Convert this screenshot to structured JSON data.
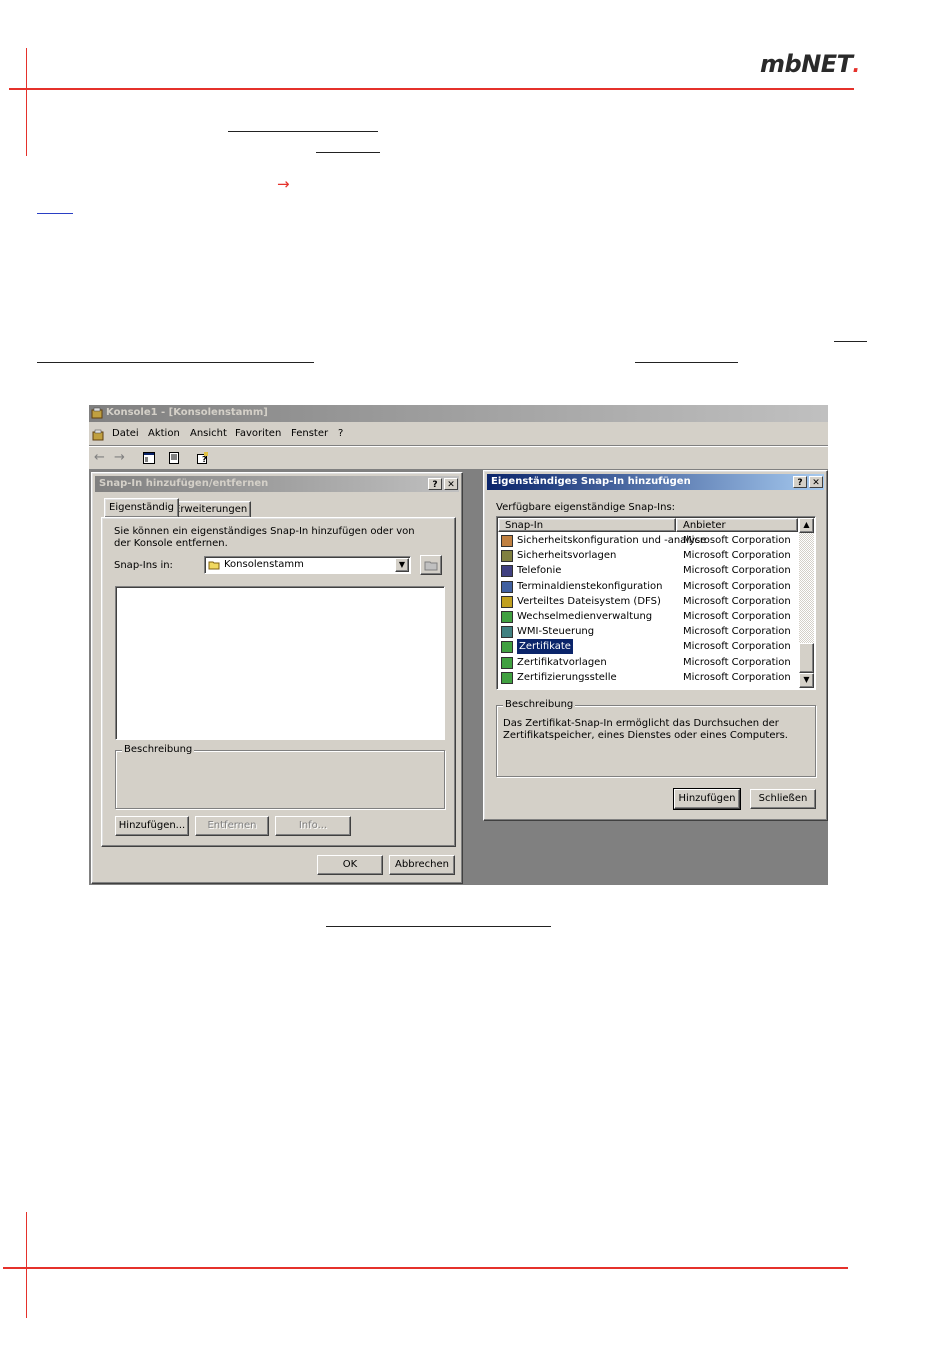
{
  "brand": {
    "logo_text": "mbNET",
    "logo_mark": "."
  },
  "arrow_glyph": "→",
  "console_window": {
    "title": "Konsole1 - [Konsolenstamm]",
    "menu": [
      "Datei",
      "Aktion",
      "Ansicht",
      "Favoriten",
      "Fenster",
      "?"
    ]
  },
  "add_remove_dialog": {
    "title": "Snap-In hinzufügen/entfernen",
    "help_btn": "?",
    "close_btn": "✕",
    "tabs": [
      "Eigenständig",
      "Erweiterungen"
    ],
    "description_text": "Sie können ein eigenständiges Snap-In hinzufügen oder von der Konsole entfernen.",
    "snapins_in_label": "Snap-Ins in:",
    "snapins_in_value": "Konsolenstamm",
    "beschreibung_label": "Beschreibung",
    "buttons": {
      "add": "Hinzufügen...",
      "remove": "Entfernen",
      "info": "Info..."
    },
    "ok": "OK",
    "cancel": "Abbrechen"
  },
  "standalone_dialog": {
    "title": "Eigenständiges Snap-In hinzufügen",
    "help_btn": "?",
    "close_btn": "✕",
    "available_label": "Verfügbare eigenständige Snap-Ins:",
    "columns": [
      "Snap-In",
      "Anbieter"
    ],
    "rows": [
      {
        "name": "Sicherheitskonfiguration und -analyse",
        "vendor": "Microsoft Corporation",
        "icon": "security-config-icon"
      },
      {
        "name": "Sicherheitsvorlagen",
        "vendor": "Microsoft Corporation",
        "icon": "security-templates-icon"
      },
      {
        "name": "Telefonie",
        "vendor": "Microsoft Corporation",
        "icon": "telephony-icon"
      },
      {
        "name": "Terminaldienstekonfiguration",
        "vendor": "Microsoft Corporation",
        "icon": "terminal-services-icon"
      },
      {
        "name": "Verteiltes Dateisystem (DFS)",
        "vendor": "Microsoft Corporation",
        "icon": "dfs-icon"
      },
      {
        "name": "Wechselmedienverwaltung",
        "vendor": "Microsoft Corporation",
        "icon": "removable-storage-icon"
      },
      {
        "name": "WMI-Steuerung",
        "vendor": "Microsoft Corporation",
        "icon": "wmi-control-icon"
      },
      {
        "name": "Zertifikate",
        "vendor": "Microsoft Corporation",
        "icon": "certificates-icon",
        "selected": true
      },
      {
        "name": "Zertifikatvorlagen",
        "vendor": "Microsoft Corporation",
        "icon": "certificate-templates-icon"
      },
      {
        "name": "Zertifizierungsstelle",
        "vendor": "Microsoft Corporation",
        "icon": "certification-authority-icon"
      }
    ],
    "beschreibung_label": "Beschreibung",
    "beschreibung_text": "Das Zertifikat-Snap-In ermöglicht das Durchsuchen der Zertifikatspeicher, eines Dienstes oder eines Computers.",
    "add_button": "Hinzufügen",
    "close_button": "Schließen"
  }
}
